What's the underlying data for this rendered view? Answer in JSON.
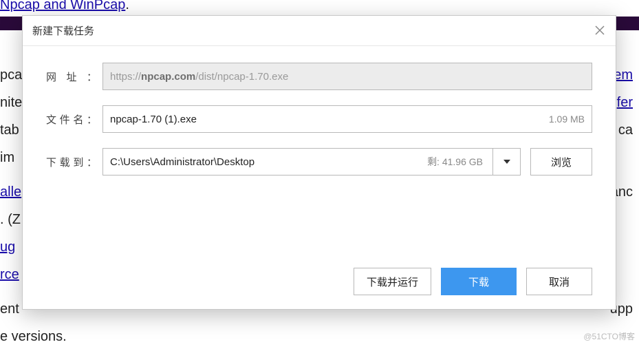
{
  "bg": {
    "heading_link": "Npcap and WinPcap",
    "heading_suffix": ".",
    "left_frag1": "pcap",
    "left_frag2": "nite",
    "left_frag3": "tab",
    "left_frag4": "im",
    "link_aller": "alle",
    "left_paren": ". (Z",
    "link_ug": "ug",
    "link_rce": "rce",
    "left_ent": "ent",
    "left_versions": "e versions.",
    "right_link1": "tem",
    "right_link2": "fer",
    "right_ca": "s ca",
    "right_anc": "anc",
    "right_upp": "upp"
  },
  "dialog": {
    "title": "新建下载任务",
    "labels": {
      "url": "网址",
      "filename": "文件名",
      "saveto": "下载到"
    },
    "url_prefix": "https://",
    "url_host": "npcap.com",
    "url_path": "/dist/npcap-1.70.exe",
    "filename": "npcap-1.70 (1).exe",
    "filesize": "1.09 MB",
    "savepath": "C:\\Users\\Administrator\\Desktop",
    "remain_label": "剩:",
    "remain_value": "41.96 GB",
    "browse": "浏览",
    "buttons": {
      "download_run": "下载并运行",
      "download": "下载",
      "cancel": "取消"
    }
  },
  "watermark": "@51CTO博客"
}
